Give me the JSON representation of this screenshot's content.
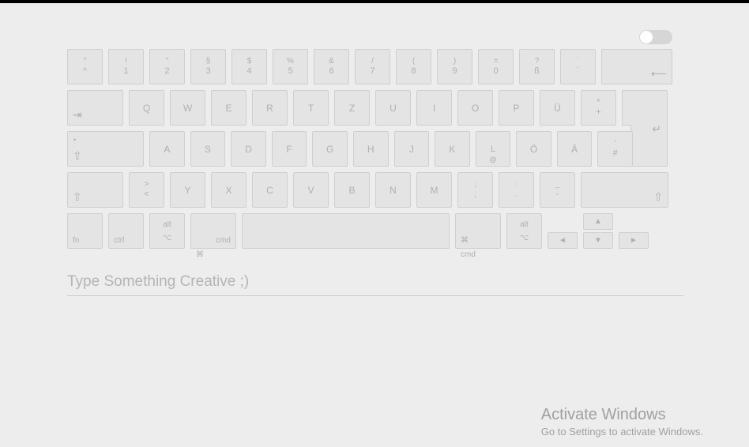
{
  "rows": {
    "r1": [
      {
        "top": "°",
        "bot": "^"
      },
      {
        "top": "!",
        "bot": "1"
      },
      {
        "top": "\"",
        "bot": "2"
      },
      {
        "top": "§",
        "bot": "3"
      },
      {
        "top": "$",
        "bot": "4"
      },
      {
        "top": "%",
        "bot": "5"
      },
      {
        "top": "&",
        "bot": "6"
      },
      {
        "top": "/",
        "bot": "7"
      },
      {
        "top": "(",
        "bot": "8"
      },
      {
        "top": ")",
        "bot": "9"
      },
      {
        "top": "=",
        "bot": "0"
      },
      {
        "top": "?",
        "bot": "ß"
      },
      {
        "top": "`",
        "bot": "´"
      }
    ],
    "r2": [
      "Q",
      "W",
      "E",
      "R",
      "T",
      "Z",
      "U",
      "I",
      "O",
      "P",
      "Ü"
    ],
    "r2_last": {
      "top": "*",
      "bot": "+"
    },
    "r3": [
      "A",
      "S",
      "D",
      "F",
      "G",
      "H",
      "J",
      "K"
    ],
    "r3_L": {
      "main": "L",
      "sub": "@"
    },
    "r3_tail": [
      "Ö",
      "Ä"
    ],
    "r3_last": {
      "top": "'",
      "bot": "#"
    },
    "r4_first": {
      "top": ">",
      "bot": "<"
    },
    "r4": [
      "Y",
      "X",
      "C",
      "V",
      "B",
      "N",
      "M"
    ],
    "r4_punct": [
      {
        "top": ";",
        "bot": ","
      },
      {
        "top": ":",
        "bot": "."
      },
      {
        "top": "_",
        "bot": "-"
      }
    ],
    "r5": {
      "fn": "fn",
      "ctrl": "ctrl",
      "alt_l_top": "alt",
      "alt_sym": "⌥",
      "cmd": "cmd",
      "cmd_sym": "⌘",
      "alt_r_top": "alt"
    }
  },
  "glyphs": {
    "backspace": "⟵",
    "tab": "⇥",
    "caps": "⇪",
    "capsdot": "•",
    "enter": "↵",
    "shift": "⇧",
    "left": "◄",
    "right": "►",
    "up": "▲",
    "down": "▼"
  },
  "input": {
    "placeholder": "Type Something Creative ;)",
    "value": ""
  },
  "watermark": {
    "title": "Activate Windows",
    "sub": "Go to Settings to activate Windows."
  }
}
